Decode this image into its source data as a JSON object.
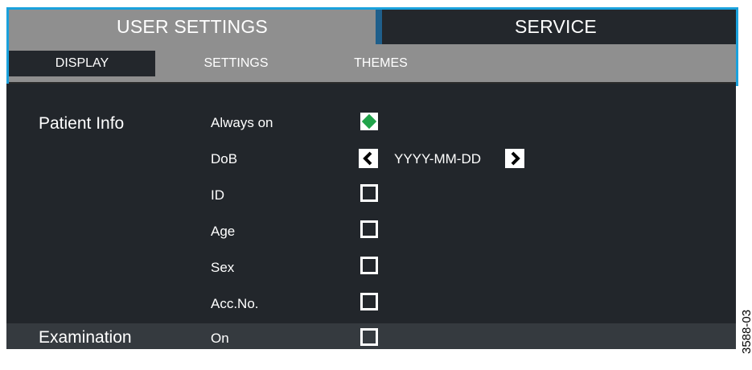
{
  "tabs": {
    "user_settings": "USER SETTINGS",
    "service": "SERVICE"
  },
  "subtabs": {
    "display": "DISPLAY",
    "settings": "SETTINGS",
    "themes": "THEMES"
  },
  "patient_info": {
    "title": "Patient Info",
    "fields": {
      "always_on": "Always on",
      "dob": "DoB",
      "id": "ID",
      "age": "Age",
      "sex": "Sex",
      "acc_no": "Acc.No."
    },
    "dob_format": "YYYY-MM-DD"
  },
  "examination": {
    "title": "Examination",
    "on": "On"
  },
  "side_code": "3588-03",
  "colors": {
    "outline": "#1aa1dc",
    "panel": "#22262b",
    "row_highlight": "#353a3f",
    "check_green": "#21a34a"
  }
}
